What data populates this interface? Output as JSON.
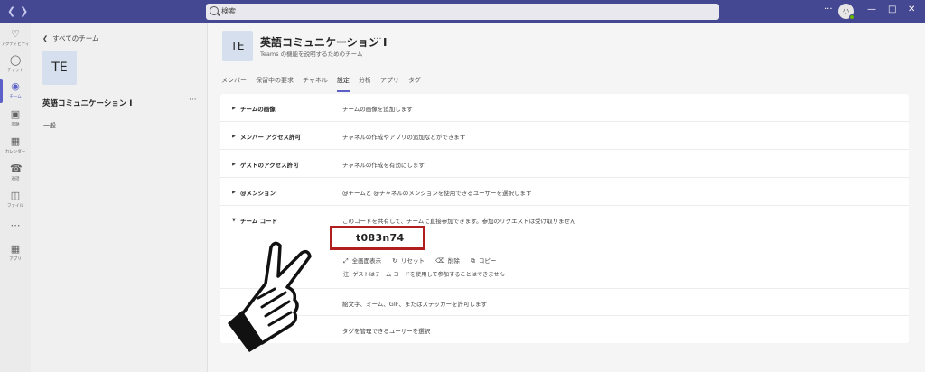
{
  "titlebar": {
    "back_icon": "chevron-left-icon",
    "forward_icon": "chevron-right-icon",
    "search_placeholder": "検索",
    "more_label": "···",
    "avatar_initials": "小",
    "minimize": "—",
    "maximize": "□",
    "close": "✕",
    "accent_color": "#444791"
  },
  "rail": {
    "items": [
      {
        "label": "アクティビティ",
        "icon": "bell-icon"
      },
      {
        "label": "チャット",
        "icon": "chat-icon"
      },
      {
        "label": "チーム",
        "icon": "teams-icon"
      },
      {
        "label": "課題",
        "icon": "assignments-icon"
      },
      {
        "label": "カレンダー",
        "icon": "calendar-icon"
      },
      {
        "label": "通話",
        "icon": "phone-icon"
      },
      {
        "label": "ファイル",
        "icon": "file-icon"
      },
      {
        "label": "",
        "icon": "more-icon"
      },
      {
        "label": "アプリ",
        "icon": "apps-icon"
      }
    ],
    "active_index": 2
  },
  "pane": {
    "back_label": "すべてのチーム",
    "tile_initials": "TE",
    "team_name": "英語コミュニケーション Ⅰ",
    "more_label": "···",
    "channel": "一般"
  },
  "main": {
    "tile_initials": "TE",
    "team_name": "英語コミュニケーション Ⅰ",
    "more_label": "···",
    "team_description": "Teams の機能を説明するためのチーム",
    "tabs": [
      "メンバー",
      "保留中の要求",
      "チャネル",
      "設定",
      "分析",
      "アプリ",
      "タグ"
    ],
    "active_tab": "設定",
    "settings": [
      {
        "name": "チームの画像",
        "desc": "チームの画像を追加します"
      },
      {
        "name": "メンバー アクセス許可",
        "desc": "チャネルの作成やアプリの追加などができます"
      },
      {
        "name": "ゲストのアクセス許可",
        "desc": "チャネルの作成を有効にします"
      },
      {
        "name": "@メンション",
        "desc": "@チームと @チャネルのメンションを使用できるユーザーを選択します"
      },
      {
        "name": "チーム コード",
        "desc": "このコードを共有して、チームに直接参加できます。参加のリクエストは受け取りません"
      },
      {
        "name": "",
        "desc": "絵文字、ミーム、GIF、またはステッカーを許可します"
      },
      {
        "name": "",
        "desc": "タグを管理できるユーザーを選択"
      }
    ],
    "team_code": "t083n74",
    "code_actions": [
      {
        "label": "全画面表示",
        "icon": "expand-icon"
      },
      {
        "label": "リセット",
        "icon": "reset-icon"
      },
      {
        "label": "削除",
        "icon": "trash-icon"
      },
      {
        "label": "コピー",
        "icon": "copy-icon"
      }
    ],
    "code_note": "注: ゲストはチーム コードを使用して参加することはできません",
    "highlight_color": "#b01e1e"
  }
}
